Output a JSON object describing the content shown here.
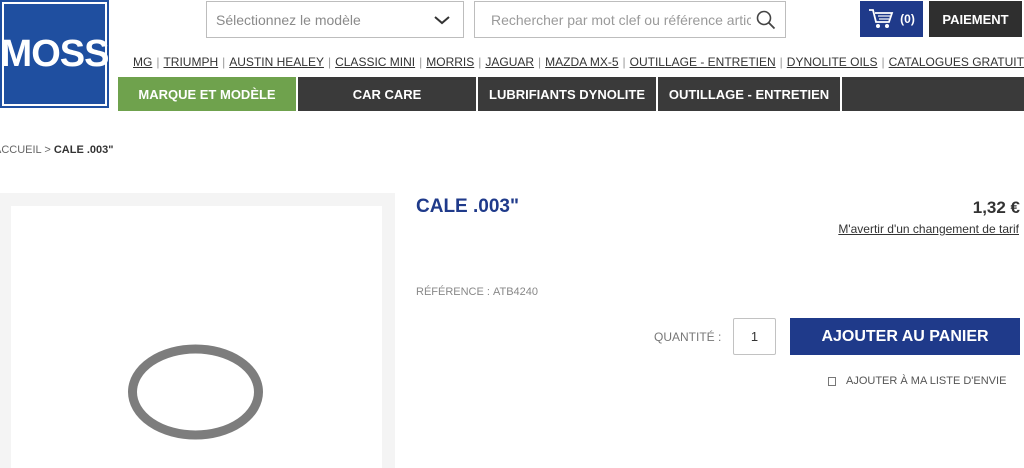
{
  "logo": {
    "text": "MOSS"
  },
  "header": {
    "model_select": {
      "value": "Sélectionnez le modèle"
    },
    "search": {
      "placeholder": "Rechercher par mot clef ou référence article"
    },
    "cart": {
      "count": "(0)"
    },
    "payment_label": "PAIEMENT"
  },
  "brand_links": [
    "MG",
    "TRIUMPH",
    "AUSTIN HEALEY",
    "CLASSIC MINI",
    "MORRIS",
    "JAGUAR",
    "MAZDA MX-5",
    "OUTILLAGE - ENTRETIEN",
    "DYNOLITE OILS",
    "CATALOGUES GRATUITS"
  ],
  "nav": [
    {
      "label": "MARQUE ET MODÈLE",
      "active": true
    },
    {
      "label": "CAR CARE",
      "active": false
    },
    {
      "label": "LUBRIFIANTS DYNOLITE",
      "active": false
    },
    {
      "label": "OUTILLAGE - ENTRETIEN",
      "active": false
    }
  ],
  "breadcrumb": {
    "home": "ACCUEIL",
    "separator": ">",
    "current": "CALE .003\""
  },
  "product": {
    "title": "CALE .003\"",
    "price": "1,32 €",
    "price_alert": "M'avertir d'un changement de tarif",
    "reference_label": "RÉFÉRENCE :",
    "reference_value": "ATB4240",
    "quantity_label": "QUANTITÉ :",
    "quantity_value": "1",
    "add_to_cart": "AJOUTER AU PANIER",
    "wishlist": "AJOUTER À MA LISTE D'ENVIE"
  },
  "colors": {
    "brand_blue": "#1f3a8a",
    "logo_blue": "#1f4fa0",
    "nav_active_green": "#6fa24d",
    "nav_dark": "#3a3a3a"
  }
}
